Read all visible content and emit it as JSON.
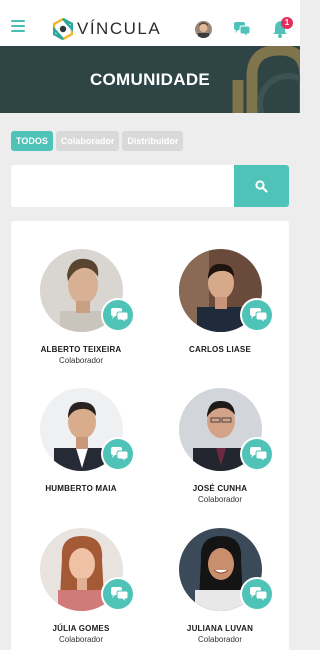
{
  "app": {
    "brand": "VÍNCULA",
    "notification_count": "1"
  },
  "banner": {
    "title": "COMUNIDADE"
  },
  "filters": [
    {
      "label": "TODOS",
      "active": true
    },
    {
      "label": "Colaborador",
      "active": false
    },
    {
      "label": "Distribuidor",
      "active": false
    }
  ],
  "search": {
    "placeholder": "",
    "value": ""
  },
  "members": [
    {
      "name": "ALBERTO TEIXEIRA",
      "role": "Colaborador"
    },
    {
      "name": "CARLOS LIASE",
      "role": ""
    },
    {
      "name": "HUMBERTO MAIA",
      "role": ""
    },
    {
      "name": "JOSÉ CUNHA",
      "role": "Colaborador"
    },
    {
      "name": "JÚLIA GOMES",
      "role": "Colaborador"
    },
    {
      "name": "JULIANA LUVAN",
      "role": "Colaborador"
    }
  ],
  "colors": {
    "accent": "#4fc3b8",
    "banner": "#2e4445",
    "badge": "#e52d5c",
    "logo_yellow": "#f2b52c",
    "logo_teal": "#2aa8a0"
  },
  "icons": {
    "menu": "hamburger-icon",
    "chat": "chat-bubbles-icon",
    "bell": "bell-icon",
    "search": "search-icon"
  }
}
